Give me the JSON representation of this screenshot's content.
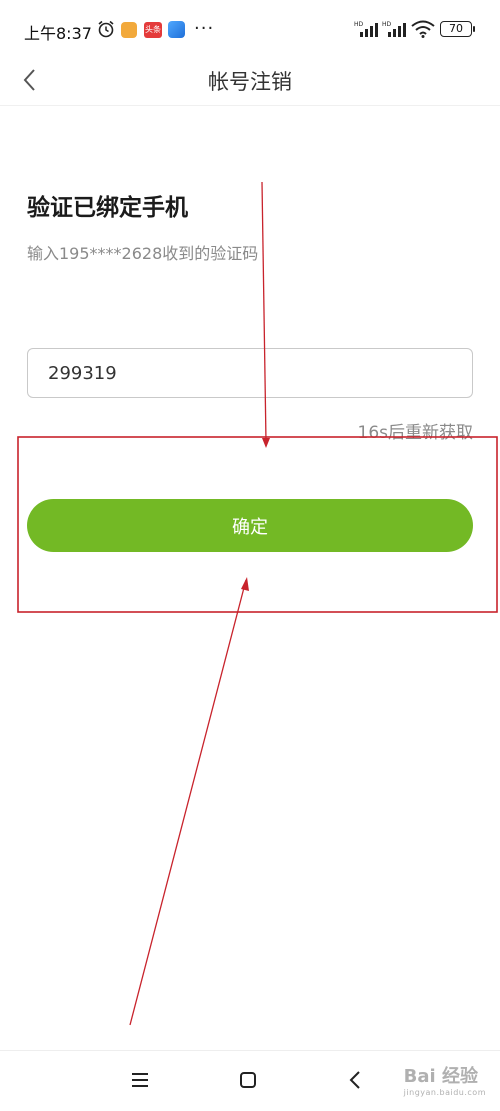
{
  "status_bar": {
    "time": "上午8:37",
    "app_badge": "头条",
    "battery": "70"
  },
  "header": {
    "title": "帐号注销"
  },
  "verify": {
    "heading": "验证已绑定手机",
    "hint": "输入195****2628收到的验证码",
    "code_value": "299319",
    "resend_label": "16s后重新获取"
  },
  "actions": {
    "confirm_label": "确定"
  },
  "watermark": {
    "text": "Bai 经验",
    "sub": "jingyan.baidu.com"
  },
  "colors": {
    "accent": "#73b925",
    "annotation": "#c8232c"
  }
}
